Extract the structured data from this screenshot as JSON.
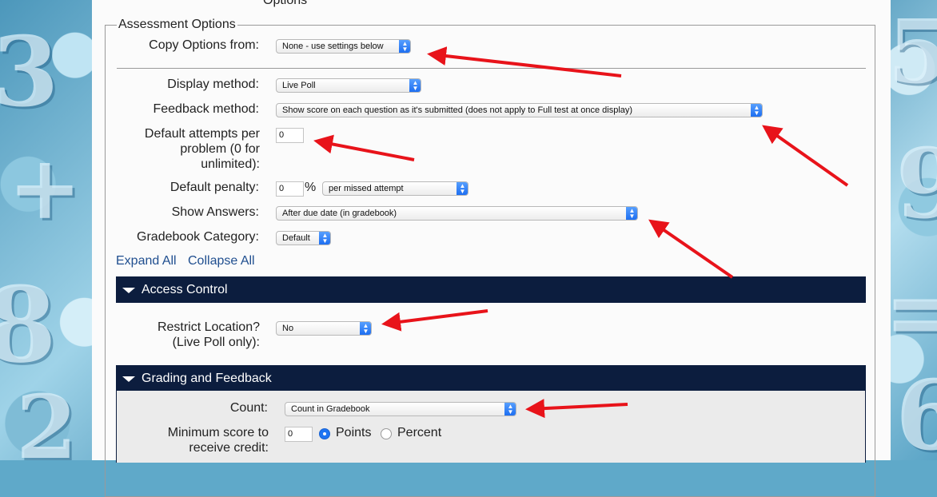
{
  "header": {
    "partial_title": "Options"
  },
  "fieldset": {
    "legend": "Assessment Options"
  },
  "copy_options": {
    "label": "Copy Options from:",
    "value": "None - use settings below"
  },
  "display_method": {
    "label": "Display method:",
    "value": "Live Poll"
  },
  "feedback_method": {
    "label": "Feedback method:",
    "value": "Show score on each question as it's submitted (does not apply to Full test at once display)"
  },
  "default_attempts": {
    "label_lines": [
      "Default attempts per",
      "problem (0 for",
      "unlimited):"
    ],
    "value": "0"
  },
  "default_penalty": {
    "label": "Default penalty:",
    "value": "0",
    "unit": "%",
    "mode": "per missed attempt"
  },
  "show_answers": {
    "label": "Show Answers:",
    "value": "After due date (in gradebook)"
  },
  "gradebook_category": {
    "label": "Gradebook Category:",
    "value": "Default"
  },
  "expand_collapse": {
    "expand": "Expand All",
    "collapse": "Collapse All"
  },
  "access_control": {
    "title": "Access Control",
    "restrict_location": {
      "label_lines": [
        "Restrict Location?",
        "(Live Poll only):"
      ],
      "value": "No"
    }
  },
  "grading_feedback": {
    "title": "Grading and Feedback",
    "count": {
      "label": "Count:",
      "value": "Count in Gradebook"
    },
    "min_score": {
      "label_lines": [
        "Minimum score to",
        "receive credit:"
      ],
      "value": "0",
      "options": [
        "Points",
        "Percent"
      ],
      "selected": "Points"
    }
  },
  "colors": {
    "section_bar": "#0c1d3e",
    "link": "#1f4e8f",
    "annotation_arrow": "#e8131a",
    "select_accent": "#1a6bf0"
  },
  "icons": {
    "select_chevron": "chevron-updown-icon",
    "section_toggle": "triangle-down-icon",
    "annotation": "arrow-icon"
  }
}
